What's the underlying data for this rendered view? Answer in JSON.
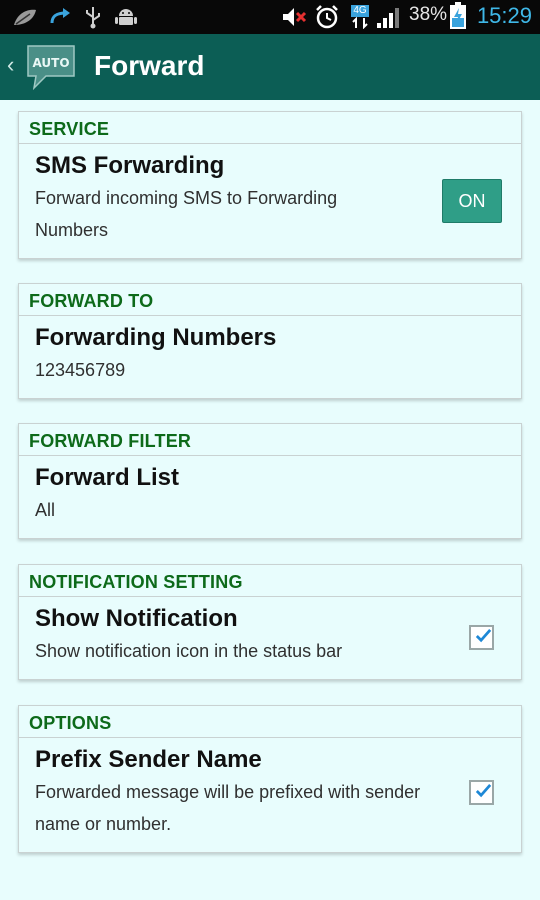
{
  "status_bar": {
    "battery": "38%",
    "time": "15:29",
    "network_badge": "4G",
    "icons": [
      "leaf-icon",
      "reply-arrow-icon",
      "usb-icon",
      "android-icon",
      "mute-icon",
      "alarm-icon",
      "signal-icon",
      "battery-charging-icon"
    ]
  },
  "header": {
    "title": "Forward",
    "logo_text": "AUTO"
  },
  "sections": [
    {
      "header": "SERVICE",
      "title": "SMS Forwarding",
      "summary_line1": "Forward incoming SMS to Forwarding",
      "summary_line2": "Numbers",
      "control": "toggle",
      "toggle_label": "ON"
    },
    {
      "header": "FORWARD TO",
      "title": "Forwarding Numbers",
      "summary_line1": "123456789"
    },
    {
      "header": "FORWARD FILTER",
      "title": "Forward List",
      "summary_line1": "All"
    },
    {
      "header": "NOTIFICATION SETTING",
      "title": "Show Notification",
      "summary_line1": "Show notification icon in the status bar",
      "control": "checkbox",
      "checked": true
    },
    {
      "header": "OPTIONS",
      "title": "Prefix Sender Name",
      "summary_line1": "Forwarded message will be prefixed with sender",
      "summary_line2": "name or number.",
      "control": "checkbox",
      "checked": true
    }
  ],
  "colors": {
    "action_bar": "#0c5e55",
    "background": "#e8fdfd",
    "section_header": "#0d6a1a",
    "toggle": "#2f9e87",
    "checkmark": "#1e88d6",
    "time": "#3fb8e8"
  }
}
